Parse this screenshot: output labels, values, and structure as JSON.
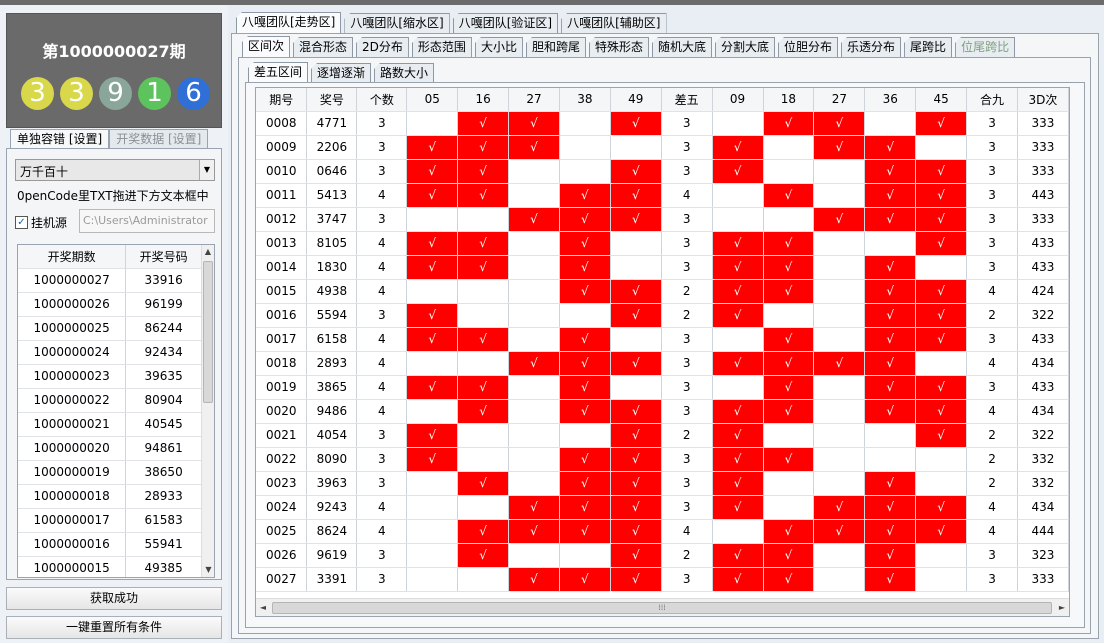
{
  "left": {
    "period_title": "第1000000027期",
    "balls": [
      {
        "value": "3",
        "color": "#d8d84a"
      },
      {
        "value": "3",
        "color": "#d8d84a"
      },
      {
        "value": "9",
        "color": "#8aa69a"
      },
      {
        "value": "1",
        "color": "#5dc35d"
      },
      {
        "value": "6",
        "color": "#2f6fd6"
      }
    ],
    "subtabs": [
      "单独容错 [设置]",
      "开奖数据 [设置]"
    ],
    "combo_value": "万千百十",
    "hint": "0penCode里TXT拖进下方文本框中",
    "checkbox_label": "挂机源",
    "checkbox_checked": true,
    "path_value": "C:\\Users\\Administrator",
    "list_headers": [
      "开奖期数",
      "开奖号码"
    ],
    "list_rows": [
      [
        "1000000027",
        "33916"
      ],
      [
        "1000000026",
        "96199"
      ],
      [
        "1000000025",
        "86244"
      ],
      [
        "1000000024",
        "92434"
      ],
      [
        "1000000023",
        "39635"
      ],
      [
        "1000000022",
        "80904"
      ],
      [
        "1000000021",
        "40545"
      ],
      [
        "1000000020",
        "94861"
      ],
      [
        "1000000019",
        "38650"
      ],
      [
        "1000000018",
        "28933"
      ],
      [
        "1000000017",
        "61583"
      ],
      [
        "1000000016",
        "55941"
      ],
      [
        "1000000015",
        "49385"
      ]
    ],
    "status_button": "获取成功",
    "reset_button": "一键重置所有条件"
  },
  "right": {
    "top_tabs": [
      "八嘎团队[走势区]",
      "八嘎团队[缩水区]",
      "八嘎团队[验证区]",
      "八嘎团队[辅助区]"
    ],
    "mid_tabs": [
      "区间次",
      "混合形态",
      "2D分布",
      "形态范围",
      "大小比",
      "胆和跨尾",
      "特殊形态",
      "随机大底",
      "分割大底",
      "位胆分布",
      "乐透分布",
      "尾跨比",
      "位尾跨比"
    ],
    "sub_tabs": [
      "差五区间",
      "逐增逐渐",
      "路数大小"
    ],
    "mark": "√",
    "columns": [
      "期号",
      "奖号",
      "个数",
      "05",
      "16",
      "27",
      "38",
      "49",
      "差五",
      "09",
      "18",
      "27",
      "36",
      "45",
      "合九",
      "3D次"
    ],
    "rows": [
      {
        "issue": "0008",
        "num": "4771",
        "count": "3",
        "a": [
          0,
          1,
          1,
          0,
          1
        ],
        "diff": "3",
        "b": [
          0,
          1,
          1,
          0,
          1
        ],
        "sum": "3",
        "d3": "333"
      },
      {
        "issue": "0009",
        "num": "2206",
        "count": "3",
        "a": [
          1,
          1,
          1,
          0,
          0
        ],
        "diff": "3",
        "b": [
          1,
          0,
          1,
          1,
          0
        ],
        "sum": "3",
        "d3": "333"
      },
      {
        "issue": "0010",
        "num": "0646",
        "count": "3",
        "a": [
          1,
          1,
          0,
          0,
          1
        ],
        "diff": "3",
        "b": [
          1,
          0,
          0,
          1,
          1
        ],
        "sum": "3",
        "d3": "333"
      },
      {
        "issue": "0011",
        "num": "5413",
        "count": "4",
        "a": [
          1,
          1,
          0,
          1,
          1
        ],
        "diff": "4",
        "b": [
          0,
          1,
          0,
          1,
          1
        ],
        "sum": "3",
        "d3": "443"
      },
      {
        "issue": "0012",
        "num": "3747",
        "count": "3",
        "a": [
          0,
          0,
          1,
          1,
          1
        ],
        "diff": "3",
        "b": [
          0,
          0,
          1,
          1,
          1
        ],
        "sum": "3",
        "d3": "333"
      },
      {
        "issue": "0013",
        "num": "8105",
        "count": "4",
        "a": [
          1,
          1,
          0,
          1,
          0
        ],
        "diff": "3",
        "b": [
          1,
          1,
          0,
          0,
          1
        ],
        "sum": "3",
        "d3": "433"
      },
      {
        "issue": "0014",
        "num": "1830",
        "count": "4",
        "a": [
          1,
          1,
          0,
          1,
          0
        ],
        "diff": "3",
        "b": [
          1,
          1,
          0,
          1,
          0
        ],
        "sum": "3",
        "d3": "433"
      },
      {
        "issue": "0015",
        "num": "4938",
        "count": "4",
        "a": [
          0,
          0,
          0,
          1,
          1
        ],
        "diff": "2",
        "b": [
          1,
          1,
          0,
          1,
          1
        ],
        "sum": "4",
        "d3": "424"
      },
      {
        "issue": "0016",
        "num": "5594",
        "count": "3",
        "a": [
          1,
          0,
          0,
          0,
          1
        ],
        "diff": "2",
        "b": [
          1,
          0,
          0,
          1,
          1
        ],
        "sum": "2",
        "d3": "322"
      },
      {
        "issue": "0017",
        "num": "6158",
        "count": "4",
        "a": [
          1,
          1,
          0,
          1,
          0
        ],
        "diff": "3",
        "b": [
          0,
          1,
          0,
          1,
          1
        ],
        "sum": "3",
        "d3": "433"
      },
      {
        "issue": "0018",
        "num": "2893",
        "count": "4",
        "a": [
          0,
          0,
          1,
          1,
          1
        ],
        "diff": "3",
        "b": [
          1,
          1,
          1,
          1,
          0
        ],
        "sum": "4",
        "d3": "434"
      },
      {
        "issue": "0019",
        "num": "3865",
        "count": "4",
        "a": [
          1,
          1,
          0,
          1,
          0
        ],
        "diff": "3",
        "b": [
          0,
          1,
          0,
          1,
          1
        ],
        "sum": "3",
        "d3": "433"
      },
      {
        "issue": "0020",
        "num": "9486",
        "count": "4",
        "a": [
          0,
          1,
          0,
          1,
          1
        ],
        "diff": "3",
        "b": [
          1,
          1,
          0,
          1,
          1
        ],
        "sum": "4",
        "d3": "434"
      },
      {
        "issue": "0021",
        "num": "4054",
        "count": "3",
        "a": [
          1,
          0,
          0,
          0,
          1
        ],
        "diff": "2",
        "b": [
          1,
          0,
          0,
          0,
          1
        ],
        "sum": "2",
        "d3": "322"
      },
      {
        "issue": "0022",
        "num": "8090",
        "count": "3",
        "a": [
          1,
          0,
          0,
          1,
          1
        ],
        "diff": "3",
        "b": [
          1,
          1,
          0,
          0,
          0
        ],
        "sum": "2",
        "d3": "332"
      },
      {
        "issue": "0023",
        "num": "3963",
        "count": "3",
        "a": [
          0,
          1,
          0,
          1,
          1
        ],
        "diff": "3",
        "b": [
          1,
          0,
          0,
          1,
          0
        ],
        "sum": "2",
        "d3": "332"
      },
      {
        "issue": "0024",
        "num": "9243",
        "count": "4",
        "a": [
          0,
          0,
          1,
          1,
          1
        ],
        "diff": "3",
        "b": [
          1,
          0,
          1,
          1,
          1
        ],
        "sum": "4",
        "d3": "434"
      },
      {
        "issue": "0025",
        "num": "8624",
        "count": "4",
        "a": [
          0,
          1,
          1,
          1,
          1
        ],
        "diff": "4",
        "b": [
          0,
          1,
          1,
          1,
          1
        ],
        "sum": "4",
        "d3": "444"
      },
      {
        "issue": "0026",
        "num": "9619",
        "count": "3",
        "a": [
          0,
          1,
          0,
          0,
          1
        ],
        "diff": "2",
        "b": [
          1,
          1,
          0,
          1,
          0
        ],
        "sum": "3",
        "d3": "323"
      },
      {
        "issue": "0027",
        "num": "3391",
        "count": "3",
        "a": [
          0,
          0,
          1,
          1,
          1
        ],
        "diff": "3",
        "b": [
          1,
          1,
          0,
          1,
          0
        ],
        "sum": "3",
        "d3": "333"
      }
    ]
  }
}
